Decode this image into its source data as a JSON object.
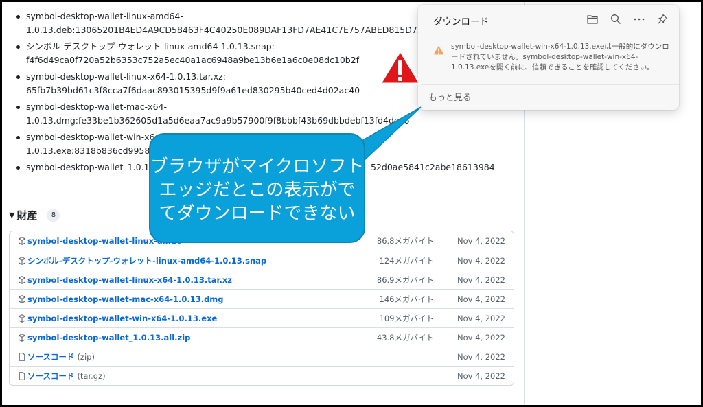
{
  "checksums": [
    {
      "line1": "symbol-desktop-wallet-linux-amd64-",
      "line2": "1.0.13.deb:13065201B4ED4A9CD58463F4C40250E089DAF13FD7AE41C7E757ABED815D755E"
    },
    {
      "line1": "シンボル-デスクトップ-ウォレット-linux-amd64-1.0.13.snap:",
      "line2": "f4f6d49ca0f720a52b6353c752a5ec40a1ac6948a9be13b6e1a6c0e08dc10b2f"
    },
    {
      "line1": "symbol-desktop-wallet-linux-x64-1.0.13.tar.xz:",
      "line2": "65fb7b39bd61c3f8cca7f6daac893015395d9f9a61ed830295b40ced4d02ac40"
    },
    {
      "line1": "symbol-desktop-wallet-mac-x64-",
      "line2": "1.0.13.dmg:fe33be1b362605d1a5d6eaa7ac9a9b57900f9f8bbbf43b69dbbdebf13fd4dca6"
    },
    {
      "line1": "symbol-desktop-wallet-win-x6",
      "line2": "1.0.13.exe:8318b836cd9958f47"
    },
    {
      "line1": "symbol-desktop-wallet_1.0.13",
      "line2": "52d0ae5841c2abe18613984"
    }
  ],
  "assets": {
    "title": "財産",
    "count": "8",
    "rows": [
      {
        "name": "symbol-desktop-wallet-linux-amd6",
        "suffix": "",
        "size": "86.8メガバイト",
        "date": "Nov 4, 2022"
      },
      {
        "name": "シンボル-デスクトップ-ウォレット-linux-amd64-1.0.13.snap",
        "suffix": "",
        "size": "124メガバイト",
        "date": "Nov 4, 2022"
      },
      {
        "name": "symbol-desktop-wallet-linux-x64-1.0.13.tar.xz",
        "suffix": "",
        "size": "86.9メガバイト",
        "date": "Nov 4, 2022"
      },
      {
        "name": "symbol-desktop-wallet-mac-x64-1.0.13.dmg",
        "suffix": "",
        "size": "146メガバイト",
        "date": "Nov 4, 2022"
      },
      {
        "name": "symbol-desktop-wallet-win-x64-1.0.13.exe",
        "suffix": "",
        "size": "109メガバイト",
        "date": "Nov 4, 2022"
      },
      {
        "name": "symbol-desktop-wallet_1.0.13.all.zip",
        "suffix": "",
        "size": "43.8メガバイト",
        "date": "Nov 4, 2022"
      },
      {
        "name": "ソースコード",
        "suffix": "(zip)",
        "size": "",
        "date": "Nov 4, 2022"
      },
      {
        "name": "ソースコード",
        "suffix": "(tar.gz)",
        "size": "",
        "date": "Nov 4, 2022"
      }
    ]
  },
  "download_panel": {
    "title": "ダウンロード",
    "message": "symbol-desktop-wallet-win-x64-1.0.13.exeは一般的にダウンロードされていません。symbol-desktop-wallet-win-x64-1.0.13.exeを開く前に、信頼できることを確認してください。",
    "more_label": "もっと見る",
    "icons": [
      "folder-icon",
      "search-icon",
      "more-icon",
      "pin-icon"
    ],
    "warning_color": "#f0a35e"
  },
  "callout": {
    "lines": [
      "ブラウザがマイクロソフト",
      "エッジだとこの表示がで",
      "てダウンロードできない"
    ],
    "color": "#0aa0da"
  },
  "alert_triangle_color": "#e0161b"
}
